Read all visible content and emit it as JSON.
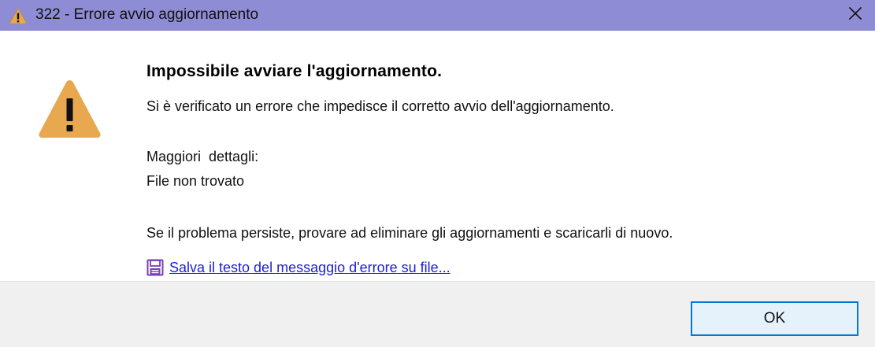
{
  "window": {
    "title": "322 - Errore avvio aggiornamento",
    "icon": "warning-icon",
    "close_icon": "close-icon"
  },
  "message": {
    "heading": "Impossibile avviare l'aggiornamento.",
    "description": "Si è verificato un errore che impedisce il corretto avvio dell'aggiornamento.",
    "details_label": "Maggiori  dettagli:",
    "details_value": "File non trovato",
    "suggestion": "Se il problema persiste, provare ad eliminare gli aggiornamenti e scaricarli di nuovo.",
    "icon": "warning-icon"
  },
  "save_link": {
    "label": "Salva il testo del messaggio d'errore su file...",
    "icon": "save-icon"
  },
  "buttons": {
    "ok_label": "OK"
  },
  "colors": {
    "titlebar": "#8f8cd6",
    "warning": "#e8a84f",
    "link": "#1e1ed6",
    "focus_border": "#0078d7",
    "footer": "#f0f0f0"
  }
}
